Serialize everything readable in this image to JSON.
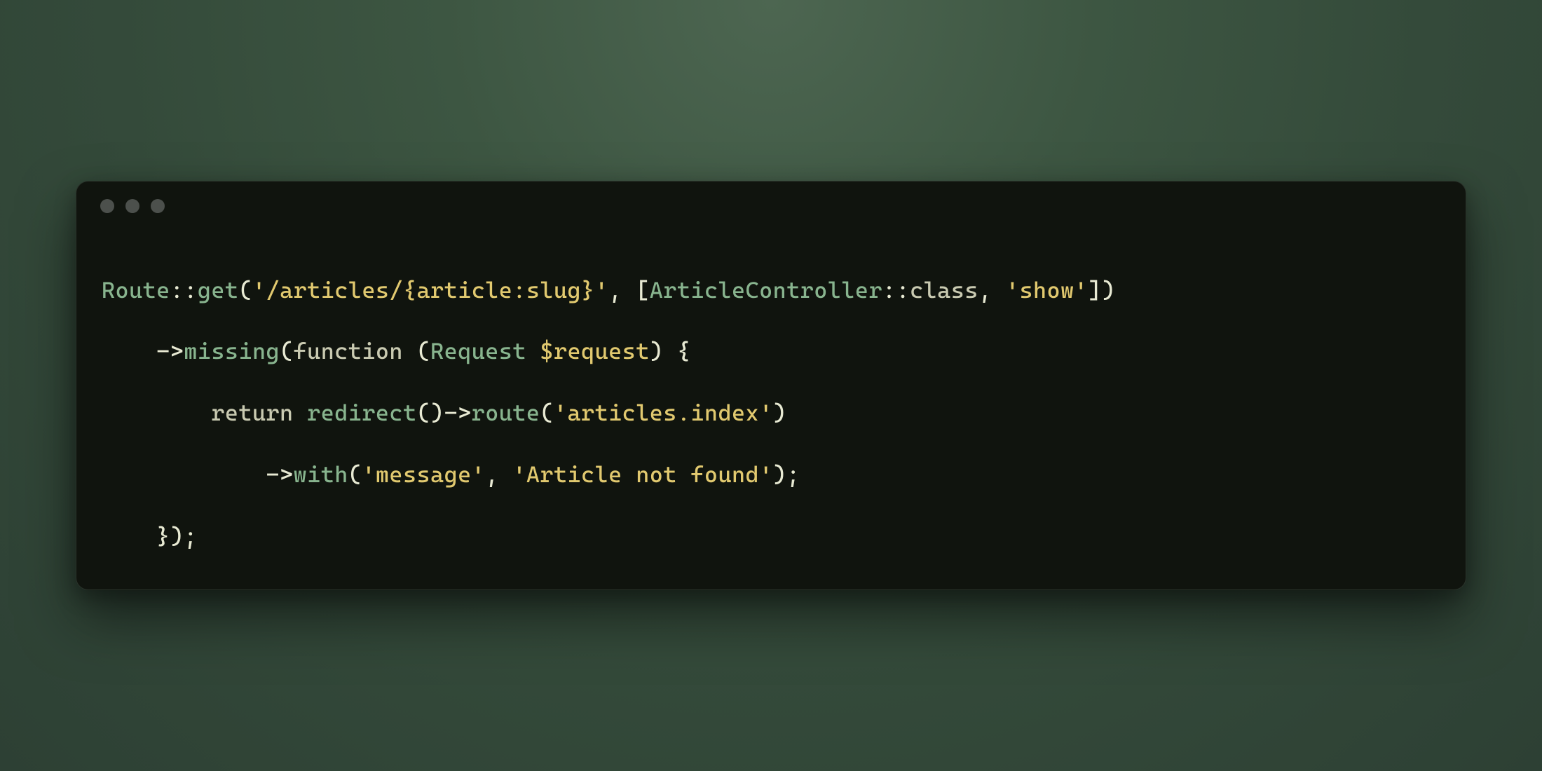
{
  "code": {
    "line1": {
      "t1": "Route",
      "t2": "::",
      "t3": "get",
      "t4": "(",
      "t5": "'/articles/{article:slug}'",
      "t6": ", [",
      "t7": "ArticleController",
      "t8": "::",
      "t9": "class",
      "t10": ", ",
      "t11": "'show'",
      "t12": "])"
    },
    "line2": {
      "t1": "    ->",
      "t2": "missing",
      "t3": "(",
      "t4": "function",
      "t5": " (",
      "t6": "Request",
      "t7": " ",
      "t8": "$request",
      "t9": ") {"
    },
    "line3": {
      "t1": "        ",
      "t2": "return",
      "t3": " ",
      "t4": "redirect",
      "t5": "()->",
      "t6": "route",
      "t7": "(",
      "t8": "'articles.index'",
      "t9": ")"
    },
    "line4": {
      "t1": "            ->",
      "t2": "with",
      "t3": "(",
      "t4": "'message'",
      "t5": ", ",
      "t6": "'Article not found'",
      "t7": ");"
    },
    "line5": {
      "t1": "    });"
    }
  }
}
